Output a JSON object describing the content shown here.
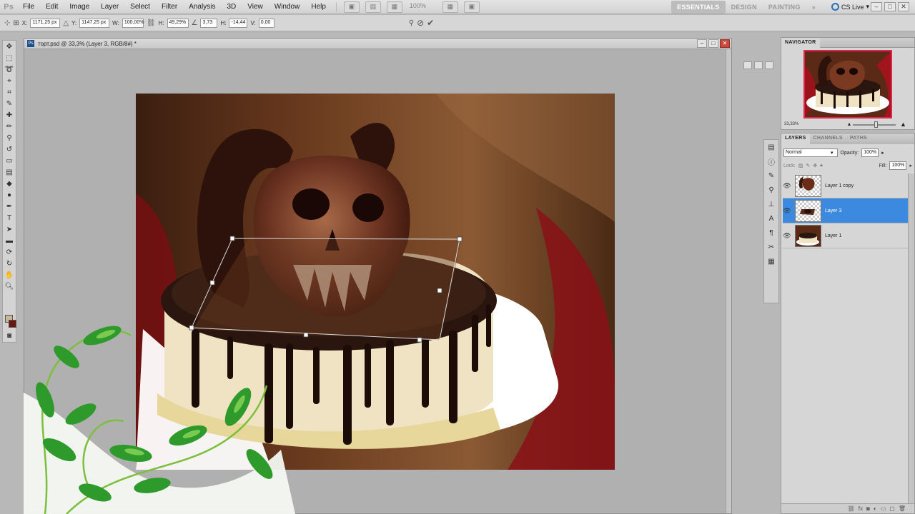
{
  "app": {
    "logo": "Ps",
    "menu": [
      "File",
      "Edit",
      "Image",
      "Layer",
      "Select",
      "Filter",
      "Analysis",
      "3D",
      "View",
      "Window",
      "Help"
    ],
    "zoom_dropdown": "100%",
    "workspaces": [
      "ESSENTIALS",
      "DESIGN",
      "PAINTING"
    ],
    "workspaces_more": "»",
    "cs_live": "CS Live"
  },
  "options_bar": {
    "x_label": "X:",
    "x_value": "1171,25 px",
    "y_label": "Y:",
    "y_value": "1147,25 px",
    "w_label": "W:",
    "w_value": "100,00%",
    "h_label": "H:",
    "h_value": "49,29%",
    "angle_value": "3,73",
    "h_skew_label": "H:",
    "h_skew_value": "-14,44",
    "v_skew_label": "V:",
    "v_skew_value": "0,00",
    "cancel_icon": "cancel-transform-icon",
    "commit_icon": "commit-transform-icon"
  },
  "document": {
    "title": "торт.psd @ 33,3% (Layer 3, RGB/8#) *"
  },
  "navigator": {
    "tab": "NAVIGATOR",
    "zoom": "33,33%"
  },
  "layers_panel": {
    "tabs": [
      "LAYERS",
      "CHANNELS",
      "PATHS"
    ],
    "blend_mode": "Normal",
    "opacity_label": "Opacity:",
    "opacity_value": "100%",
    "lock_label": "Lock:",
    "fill_label": "Fill:",
    "fill_value": "100%",
    "layers": [
      {
        "name": "Layer 1 copy",
        "selected": false
      },
      {
        "name": "Layer 3",
        "selected": true
      },
      {
        "name": "Layer 1",
        "selected": false
      }
    ]
  },
  "colors": {
    "selection": "#3c8ae0",
    "foreground_swatch": "#c8b698",
    "background_swatch": "#6a1710"
  }
}
